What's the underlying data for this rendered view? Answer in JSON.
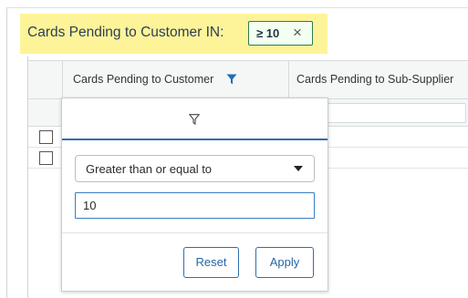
{
  "active_filter": {
    "label": "Cards Pending to Customer IN:",
    "chip_value": "≥ 10",
    "chip_close": "×"
  },
  "grid": {
    "columns": [
      "Cards Pending to Customer",
      "Cards Pending to Sub-Supplier"
    ],
    "rows": [
      {
        "checked": false
      },
      {
        "checked": false
      }
    ]
  },
  "filter_popup": {
    "tab_icon": "filter-icon",
    "operator": "Greater than or equal to",
    "value": "10",
    "reset_label": "Reset",
    "apply_label": "Apply"
  },
  "colors": {
    "highlight": "#fdf49a",
    "chip_border": "#2e7a50",
    "accent": "#2f6fad",
    "active_filter_icon": "#1e6fb9"
  }
}
